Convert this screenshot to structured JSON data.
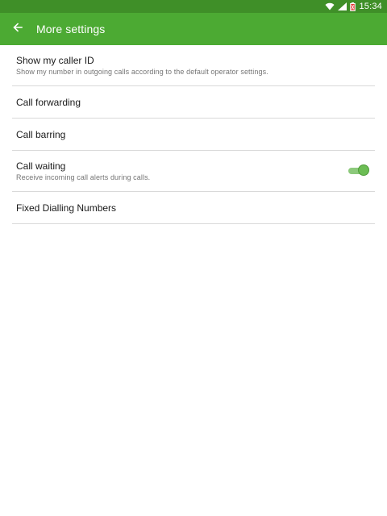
{
  "status_bar": {
    "time": "15:34",
    "icons": [
      "wifi-icon",
      "signal-icon",
      "battery-icon"
    ],
    "color": "#3f8f28"
  },
  "app_bar": {
    "title": "More settings",
    "back_icon": "back-arrow-icon",
    "color": "#4caa33"
  },
  "settings": {
    "items": [
      {
        "title": "Show my caller ID",
        "subtitle": "Show my number in outgoing calls according to the default operator settings."
      },
      {
        "title": "Call forwarding"
      },
      {
        "title": "Call barring"
      },
      {
        "title": "Call waiting",
        "subtitle": "Receive incoming call alerts during calls.",
        "toggle": "on"
      },
      {
        "title": "Fixed Dialling Numbers"
      }
    ]
  }
}
